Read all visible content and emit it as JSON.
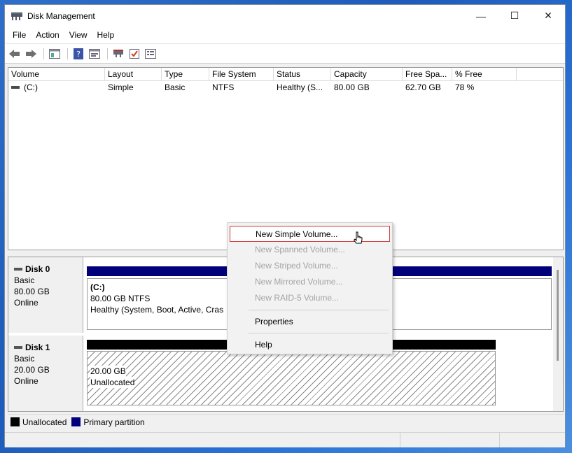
{
  "window": {
    "title": "Disk Management",
    "controls": {
      "minimize": "—",
      "maximize": "☐",
      "close": "✕"
    }
  },
  "menu": [
    "File",
    "Action",
    "View",
    "Help"
  ],
  "toolbar": {
    "icons": [
      "back-arrow-icon",
      "forward-arrow-icon",
      "console-tree-icon",
      "help-icon",
      "properties-icon",
      "connect-icon",
      "check-icon",
      "list-icon"
    ]
  },
  "volume_list": {
    "columns": [
      "Volume",
      "Layout",
      "Type",
      "File System",
      "Status",
      "Capacity",
      "Free Spa...",
      "% Free"
    ],
    "rows": [
      {
        "volume": "(C:)",
        "layout": "Simple",
        "type": "Basic",
        "file_system": "NTFS",
        "status": "Healthy (S...",
        "capacity": "80.00 GB",
        "free_space": "62.70 GB",
        "percent_free": "78 %"
      }
    ]
  },
  "disks": [
    {
      "name": "Disk 0",
      "type": "Basic",
      "size": "80.00 GB",
      "state": "Online",
      "partition": {
        "label": "(C:)",
        "size_fs": "80.00 GB NTFS",
        "health": "Healthy (System, Boot, Active, Cras"
      },
      "bar_color": "#00007b"
    },
    {
      "name": "Disk 1",
      "type": "Basic",
      "size": "20.00 GB",
      "state": "Online",
      "partition": {
        "size": "20.00 GB",
        "status": "Unallocated"
      },
      "bar_color": "#000000"
    }
  ],
  "legend": [
    {
      "label": "Unallocated",
      "color": "#000000"
    },
    {
      "label": "Primary partition",
      "color": "#00007b"
    }
  ],
  "context_menu": {
    "items": [
      {
        "label": "New Simple Volume...",
        "enabled": true,
        "highlighted": true
      },
      {
        "label": "New Spanned Volume...",
        "enabled": false
      },
      {
        "label": "New Striped Volume...",
        "enabled": false
      },
      {
        "label": "New Mirrored Volume...",
        "enabled": false
      },
      {
        "label": "New RAID-5 Volume...",
        "enabled": false
      },
      {
        "label": "Properties",
        "enabled": true
      },
      {
        "label": "Help",
        "enabled": true
      }
    ]
  },
  "colors": {
    "primary_partition": "#00007b",
    "unallocated": "#000000",
    "highlight_border": "#d23c3c"
  }
}
